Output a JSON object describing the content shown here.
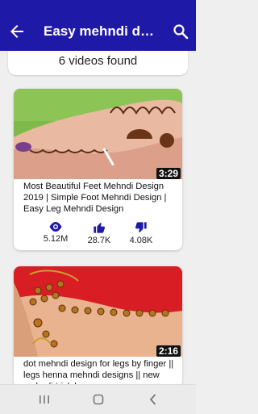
{
  "header": {
    "title": "Easy mehndi designs"
  },
  "summary": {
    "count_text": "6 videos found"
  },
  "videos": [
    {
      "duration": "3:29",
      "title": "Most Beautiful Feet Mehndi Design 2019 | Simple Foot Mehndi Design | Easy Leg Mehndi Design",
      "views": "5.12M",
      "likes": "28.7K",
      "dislikes": "4.08K"
    },
    {
      "duration": "2:16",
      "title": "dot mehndi design for legs by finger || legs henna mehndi designs || new mehndi trick by",
      "views": "",
      "likes": "",
      "dislikes": ""
    }
  ],
  "colors": {
    "primary": "#1f19a8",
    "icon_blue": "#1f19a8"
  },
  "icons": {
    "back": "arrow-left-icon",
    "search": "search-icon",
    "views": "eye-icon",
    "likes": "thumbs-up-icon",
    "dislikes": "thumbs-down-icon",
    "nav_recent": "recent-apps-icon",
    "nav_home": "home-icon",
    "nav_back": "back-icon"
  }
}
